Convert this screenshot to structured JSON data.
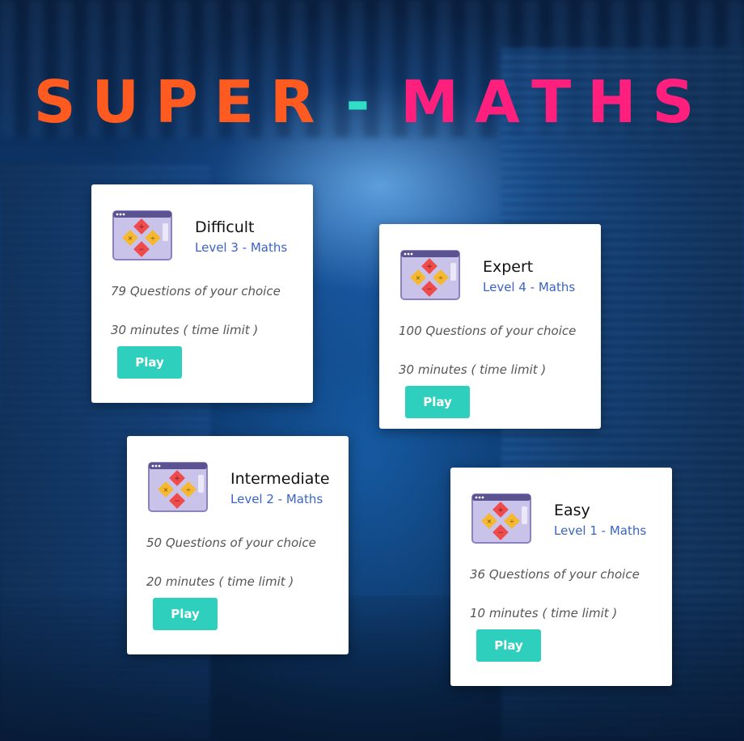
{
  "title": {
    "part1": "SUPER",
    "separator": "-",
    "part2": "MATHS"
  },
  "colors": {
    "title_part1": "#ff5a1f",
    "title_separator": "#2fe0c6",
    "title_part2": "#ff1f7d",
    "level_text": "#3a63c8",
    "play_button": "#2ecfbd"
  },
  "cards": [
    {
      "icon": "calculator-window-icon",
      "name": "Difficult",
      "level": "Level 3 - Maths",
      "questions": "79 Questions of your choice",
      "time": "30 minutes ( time limit )",
      "play_label": "Play"
    },
    {
      "icon": "calculator-window-icon",
      "name": "Expert",
      "level": "Level 4 - Maths",
      "questions": "100 Questions of your choice",
      "time": "30 minutes ( time limit )",
      "play_label": "Play"
    },
    {
      "icon": "calculator-window-icon",
      "name": "Intermediate",
      "level": "Level 2 - Maths",
      "questions": "50 Questions of your choice",
      "time": "20 minutes ( time limit )",
      "play_label": "Play"
    },
    {
      "icon": "calculator-window-icon",
      "name": "Easy",
      "level": "Level 1 - Maths",
      "questions": "36 Questions of your choice",
      "time": "10 minutes ( time limit )",
      "play_label": "Play"
    }
  ]
}
